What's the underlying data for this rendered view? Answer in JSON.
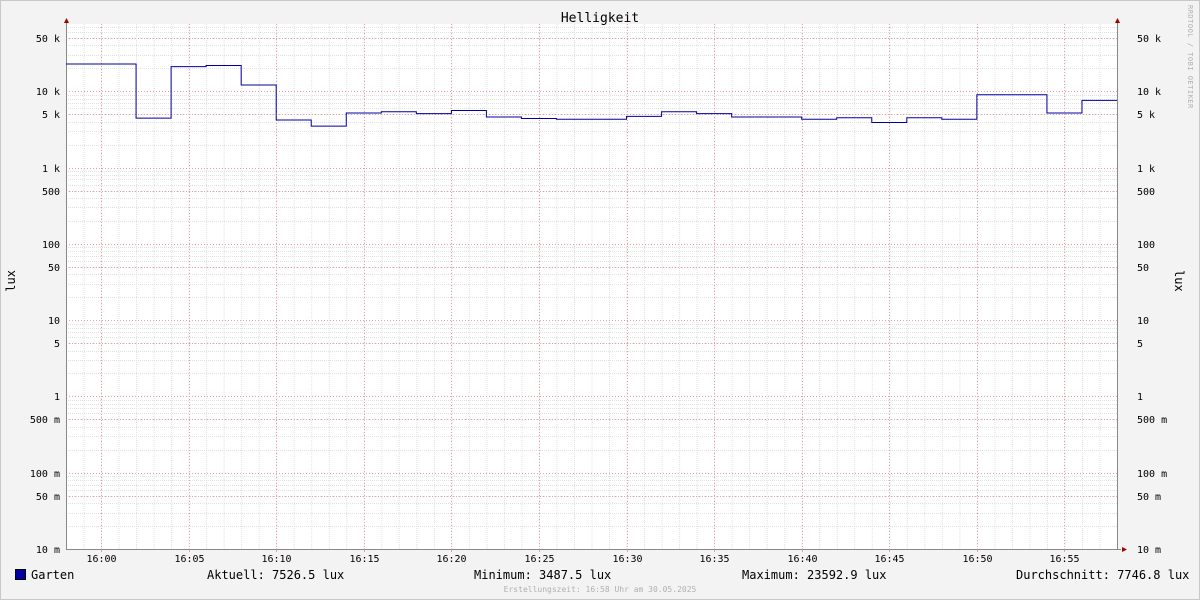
{
  "title": "Helligkeit",
  "watermark": "RRDTOOL / TOBI OETIKER",
  "ylabel": "lux",
  "legend": {
    "series_name": "Garten",
    "series_color": "#0000a0",
    "current": "Aktuell: 7526.5 lux",
    "minimum": "Minimum: 3487.5 lux",
    "maximum": "Maximum: 23592.9 lux",
    "average": "Durchschnitt: 7746.8 lux"
  },
  "footer": "Erstellungszeit: 16:58 Uhr am 30.05.2025",
  "chart_data": {
    "type": "line",
    "title": "Helligkeit",
    "xlabel": "",
    "ylabel": "lux",
    "y_scale": "log",
    "ylim": [
      0.01,
      70000
    ],
    "grid": true,
    "x_ticks": [
      "16:00",
      "16:05",
      "16:10",
      "16:15",
      "16:20",
      "16:25",
      "16:30",
      "16:35",
      "16:40",
      "16:45",
      "16:50",
      "16:55"
    ],
    "y_ticks": [
      {
        "value": 0.01,
        "label": "10 m"
      },
      {
        "value": 0.05,
        "label": "50 m"
      },
      {
        "value": 0.1,
        "label": "100 m"
      },
      {
        "value": 0.5,
        "label": "500 m"
      },
      {
        "value": 1,
        "label": "1"
      },
      {
        "value": 5,
        "label": "5"
      },
      {
        "value": 10,
        "label": "10"
      },
      {
        "value": 50,
        "label": "50"
      },
      {
        "value": 100,
        "label": "100"
      },
      {
        "value": 500,
        "label": "500"
      },
      {
        "value": 1000,
        "label": "1 k"
      },
      {
        "value": 5000,
        "label": "5 k"
      },
      {
        "value": 10000,
        "label": "10 k"
      },
      {
        "value": 50000,
        "label": "50 k"
      }
    ],
    "series": [
      {
        "name": "Garten",
        "step": true,
        "start": "15:58",
        "step_minutes": 2,
        "values": [
          22800,
          22800,
          4450,
          21100,
          21800,
          12100,
          4200,
          3500,
          5200,
          5400,
          5100,
          5600,
          4600,
          4400,
          4300,
          4300,
          4700,
          5400,
          5100,
          4600,
          4600,
          4300,
          4500,
          3900,
          4500,
          4300,
          9000,
          9000,
          5200,
          7600
        ]
      }
    ]
  }
}
